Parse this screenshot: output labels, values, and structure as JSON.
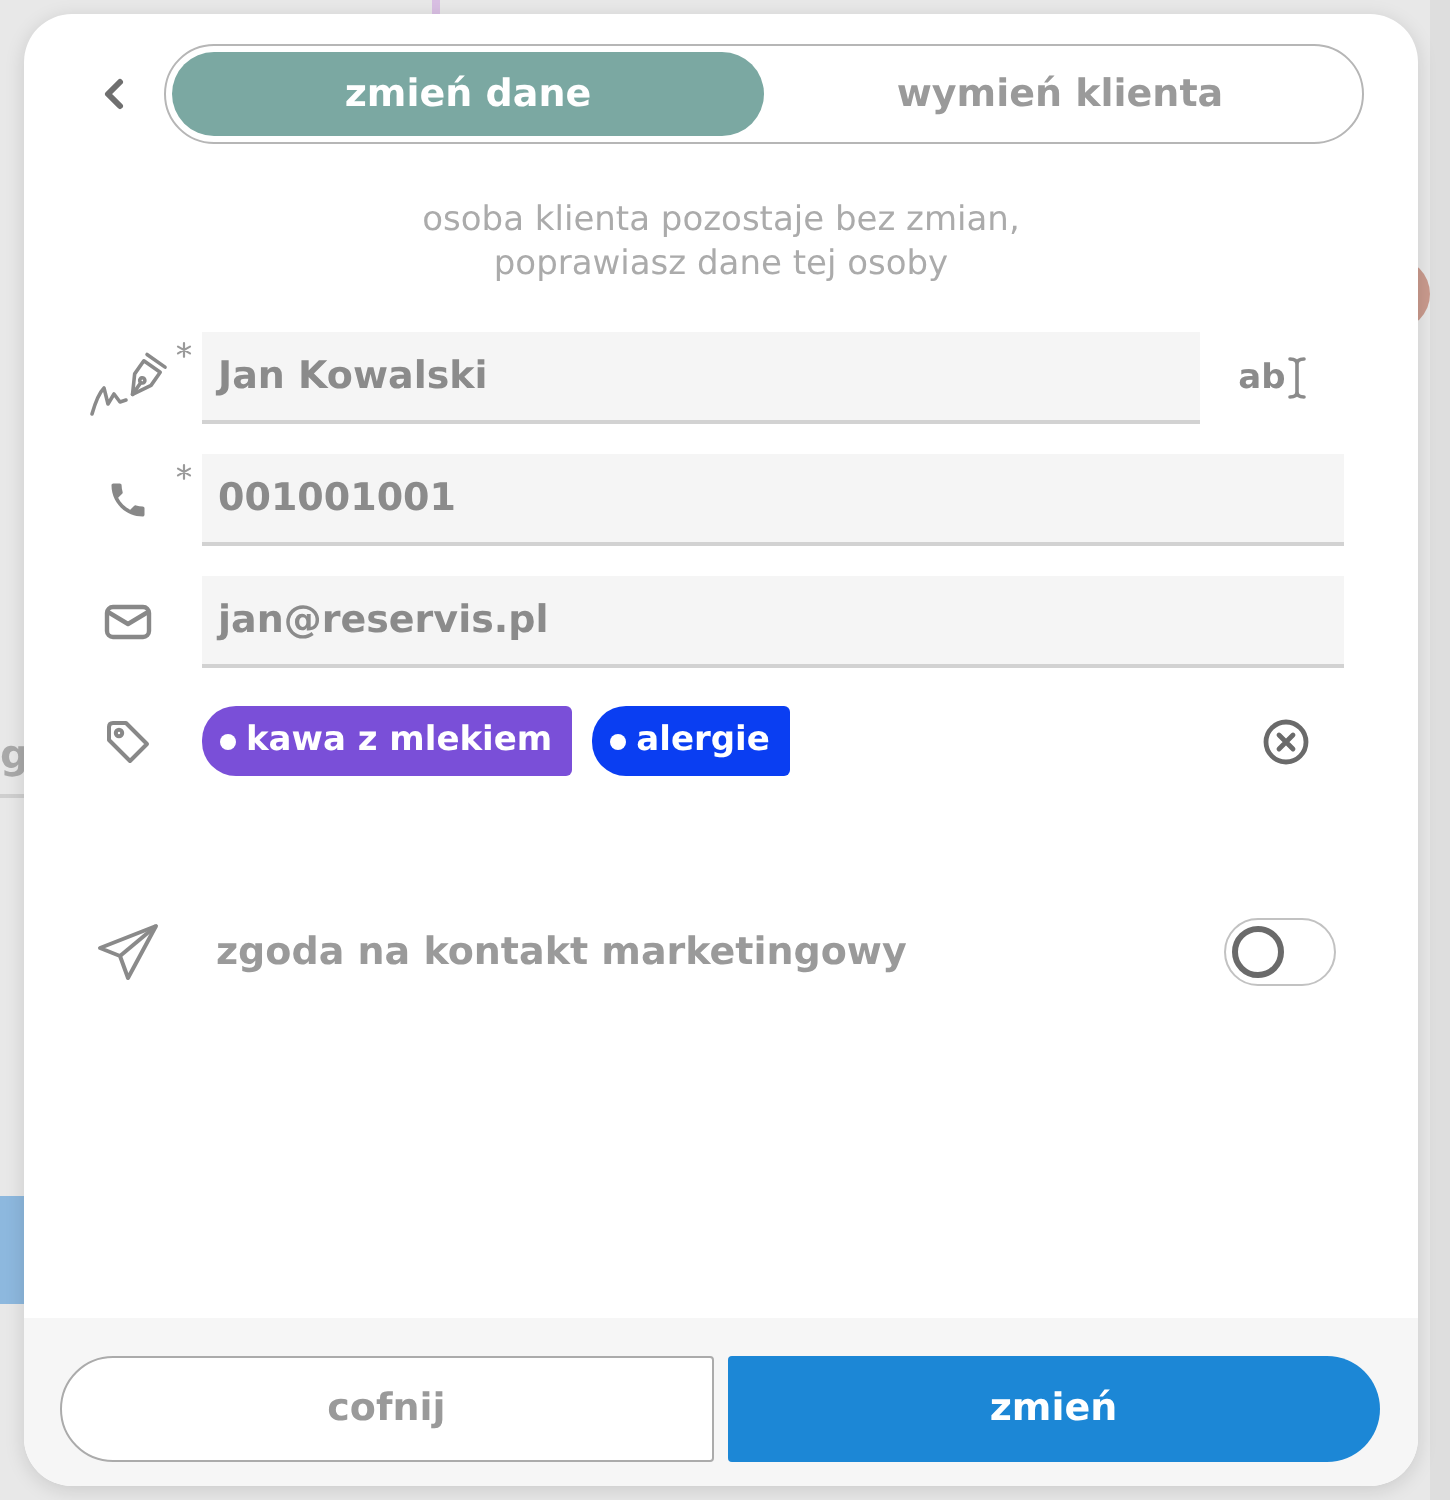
{
  "backdrop": {
    "edge_text": "g"
  },
  "dialog": {
    "tabs": [
      {
        "label": "zmień dane",
        "selected": true
      },
      {
        "label": "wymień klienta",
        "selected": false
      }
    ],
    "hint": "osoba klienta pozostaje bez zmian,\npoprawiasz dane tej osoby",
    "fields": [
      {
        "kind": "name",
        "value": "Jan Kowalski",
        "required": true,
        "trailing_label": "ab"
      },
      {
        "kind": "phone",
        "value": "001001001",
        "required": true
      },
      {
        "kind": "email",
        "value": "jan@reservis.pl",
        "required": false
      }
    ],
    "tags": [
      {
        "label": "kawa z mlekiem",
        "color": "#7a4fd8"
      },
      {
        "label": "alergie",
        "color": "#0a3ef2"
      }
    ],
    "consent": {
      "label": "zgoda na kontakt marketingowy",
      "on": false
    },
    "buttons": [
      {
        "kind": "secondary",
        "label": "cofnij"
      },
      {
        "kind": "primary",
        "label": "zmień"
      }
    ]
  }
}
